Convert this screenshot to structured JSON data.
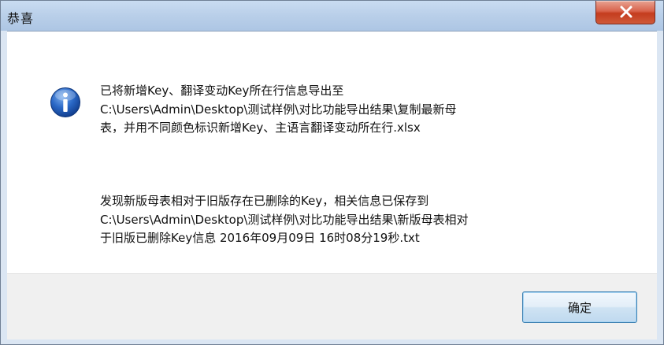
{
  "window": {
    "title": "恭喜"
  },
  "icons": {
    "close": "close-x-icon",
    "message": "information-icon"
  },
  "colors": {
    "title_bar": "#b9cfe9",
    "close_button": "#c43c1e",
    "info_icon": "#1f5bb5",
    "ok_border": "#3c7fb1"
  },
  "message": {
    "paragraph1": [
      "已将新增Key、翻译变动Key所在行信息导出至",
      "C:\\Users\\Admin\\Desktop\\测试样例\\对比功能导出结果\\复制最新母",
      "表，并用不同颜色标识新增Key、主语言翻译变动所在行.xlsx"
    ],
    "paragraph2": [
      "发现新版母表相对于旧版存在已删除的Key，相关信息已保存到",
      "C:\\Users\\Admin\\Desktop\\测试样例\\对比功能导出结果\\新版母表相对",
      "于旧版已删除Key信息 2016年09月09日 16时08分19秒.txt"
    ]
  },
  "buttons": {
    "ok_label": "确定"
  }
}
